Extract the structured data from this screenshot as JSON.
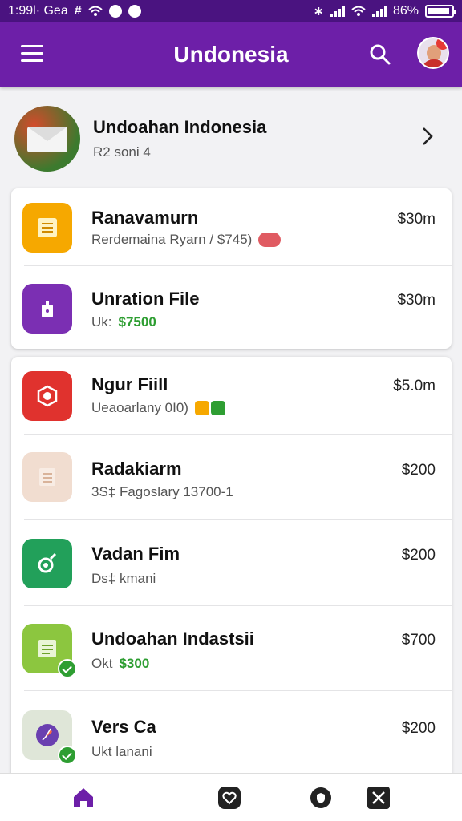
{
  "status_bar": {
    "time": "1:99l· Gea",
    "battery": "86%"
  },
  "app_bar": {
    "title": "Undonesia"
  },
  "profile": {
    "name": "Undoahan Indonesia",
    "subtitle": "R2 soni 4"
  },
  "group1": [
    {
      "title": "Ranavamurn",
      "subtitle": "Rerdemaina Ryarn / $745)",
      "price": "$30m",
      "icon": "document-icon",
      "color": "#f6a800"
    },
    {
      "title": "Unration File",
      "subtitle": "Uk:",
      "subtitle_value": "$7500",
      "price": "$30m",
      "icon": "lock-icon",
      "color": "#7b2fb3"
    }
  ],
  "group2": [
    {
      "title": "Ngur Fiill",
      "subtitle": "Ueaoarlany 0I0)",
      "price": "$5.0m",
      "icon": "camera-icon",
      "color": "#e0322e"
    },
    {
      "title": "Radakiarm",
      "subtitle": "3S‡ Fagoslary 13700-1",
      "price": "$200",
      "icon": "document-icon",
      "color": "#f1ddd0"
    },
    {
      "title": "Vadan Fim",
      "subtitle": "Ds‡ kmani",
      "price": "$200",
      "icon": "music-icon",
      "color": "#22a05a"
    },
    {
      "title": "Undoahan Indastsii",
      "subtitle": "Okt",
      "subtitle_value": "$300",
      "price": "$700",
      "icon": "document-icon",
      "color": "#8cc63f"
    },
    {
      "title": "Vers Ca",
      "subtitle": "Ukt lanani",
      "price": "$200",
      "icon": "compass-icon",
      "color": "#dfe6d8"
    }
  ],
  "bottom_nav": [
    {
      "icon": "home-icon"
    },
    {
      "icon": "heart-icon"
    },
    {
      "icon": "shield-icon"
    },
    {
      "icon": "close-icon"
    }
  ]
}
